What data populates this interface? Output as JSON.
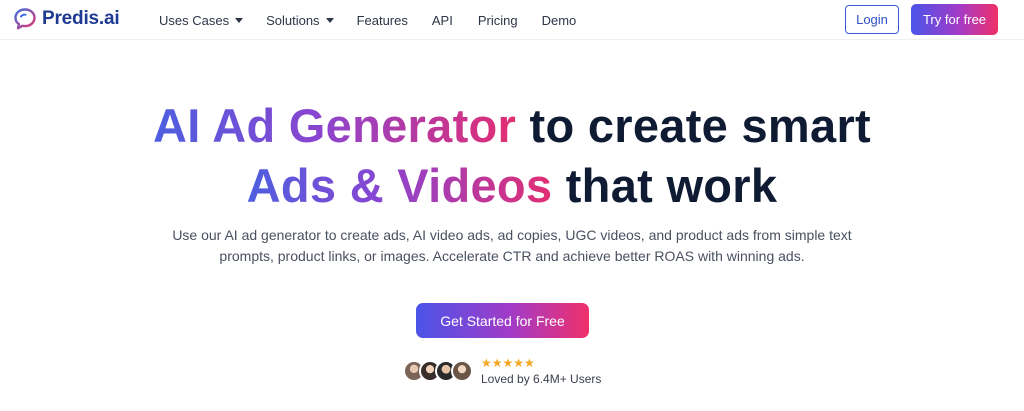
{
  "brand": {
    "name": "Predis.ai"
  },
  "nav": {
    "items": [
      {
        "label": "Uses Cases",
        "dropdown": true
      },
      {
        "label": "Solutions",
        "dropdown": true
      },
      {
        "label": "Features",
        "dropdown": false
      },
      {
        "label": "API",
        "dropdown": false
      },
      {
        "label": "Pricing",
        "dropdown": false
      },
      {
        "label": "Demo",
        "dropdown": false
      }
    ],
    "login_label": "Login",
    "try_label": "Try for free"
  },
  "hero": {
    "line1_grad": "AI Ad Generator",
    "line1_rest": " to create smart",
    "line2_grad": "Ads & Videos",
    "line2_rest": " that work",
    "subtext": "Use our AI ad generator to create ads, AI video ads, ad copies, UGC videos, and product ads from simple text prompts, product links, or images. Accelerate CTR and achieve better ROAS with winning ads.",
    "cta_label": "Get Started for Free"
  },
  "social_proof": {
    "stars": "★★★★★",
    "rating": 5,
    "text": "Loved by 6.4M+ Users"
  },
  "colors": {
    "brand_blue": "#1f3a93",
    "gradient_start": "#4b54e8",
    "gradient_mid": "#a23bc7",
    "gradient_end": "#f0306a",
    "headline": "#0f1b33",
    "star": "#f5a623"
  }
}
